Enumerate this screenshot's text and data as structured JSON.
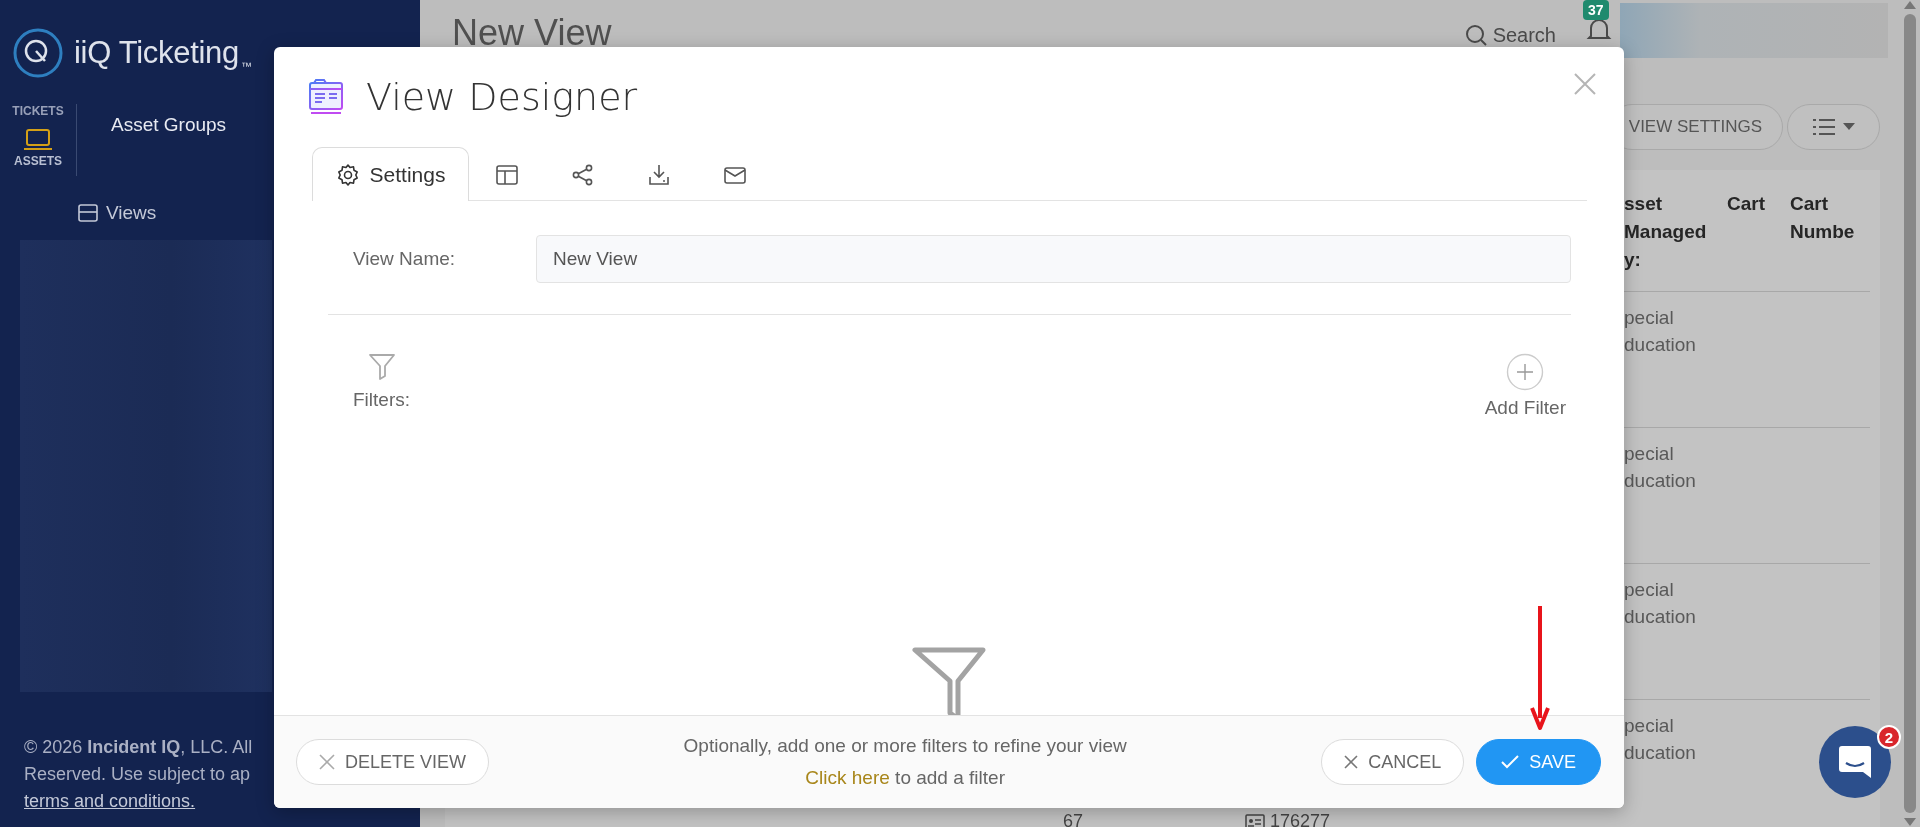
{
  "sidebar": {
    "brand": "iiQ Ticketing",
    "trademark": "™",
    "modules": [
      {
        "label": "TICKETS",
        "selected": false
      },
      {
        "label": "ASSETS",
        "kind": "laptop",
        "selected": true
      }
    ],
    "section_title": "Asset Groups",
    "nav_items": [
      {
        "label": "Views"
      }
    ],
    "footer": {
      "lines": [
        "© 2026 **Incident IQ**, LLC. All",
        "Reserved. Use subject to ap"
      ],
      "link": "terms and conditions."
    }
  },
  "main": {
    "title": "New View",
    "search": "Search",
    "notification_count": "37",
    "view_settings": "VIEW SETTINGS",
    "table": {
      "columns": [
        "sset Managed y:",
        "Cart",
        "Cart Numbe"
      ],
      "rows": [
        {
          "cells": [
            "pecial ducation"
          ]
        },
        {
          "cells": [
            "pecial ducation"
          ]
        },
        {
          "cells": [
            "pecial ducation"
          ]
        },
        {
          "cells": [
            "pecial ducation"
          ]
        }
      ],
      "partial_row": [
        "67",
        "176277"
      ]
    }
  },
  "modal": {
    "title": "View Designer",
    "tabs": [
      {
        "kind": "settings",
        "label": "Settings",
        "selected": true
      },
      {
        "kind": "layout",
        "selected": false
      },
      {
        "kind": "share",
        "selected": false
      },
      {
        "kind": "export",
        "selected": false
      },
      {
        "kind": "email",
        "selected": false
      }
    ],
    "view_name": {
      "label": "View Name:",
      "value": "New View"
    },
    "filters": {
      "label": "Filters:",
      "add": "Add Filter"
    },
    "empty_state": {
      "message": "Optionally, add one or more filters to refine your view",
      "link": "Click here",
      "rest": "to add a filter"
    },
    "buttons": {
      "delete": "DELETE VIEW",
      "cancel": "CANCEL",
      "save": "SAVE"
    }
  },
  "chat": {
    "badge": "2"
  }
}
